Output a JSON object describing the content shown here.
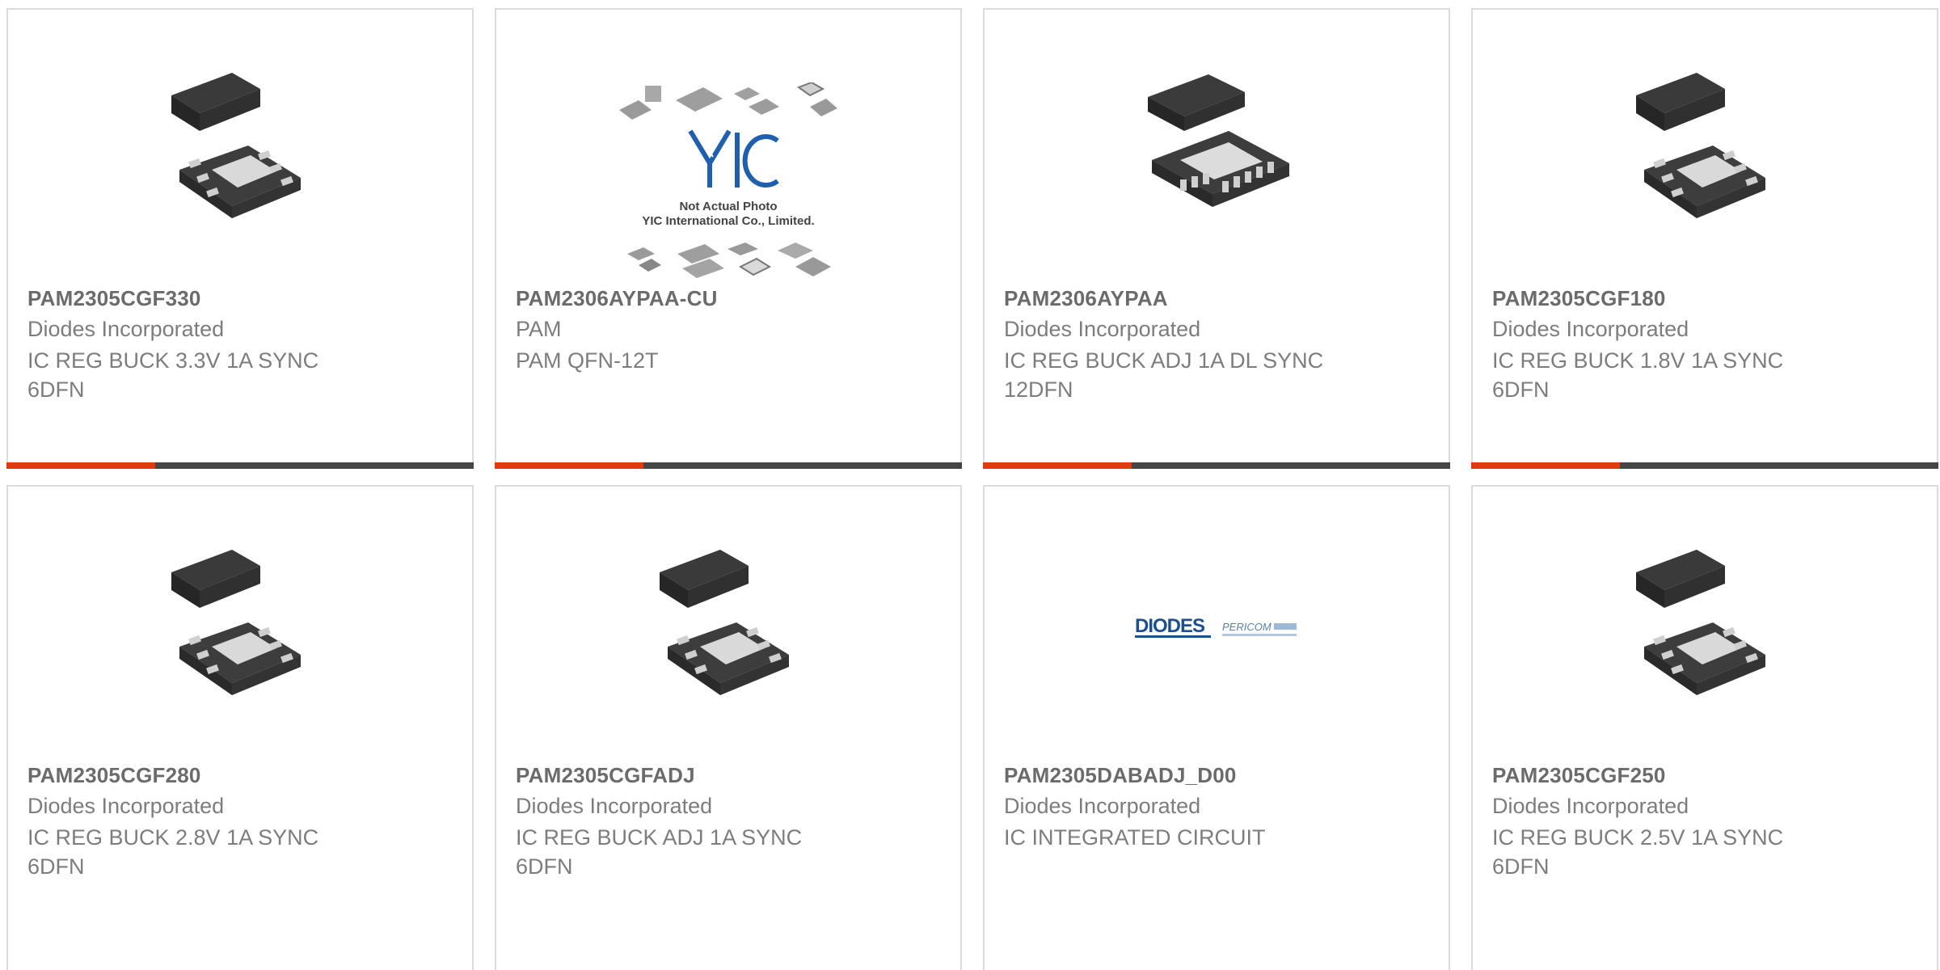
{
  "accent_color": "#e03a10",
  "bar_color": "#454545",
  "products": [
    {
      "part": "PAM2305CGF330",
      "maker": "Diodes Incorporated",
      "desc": "IC REG BUCK 3.3V 1A SYNC 6DFN",
      "image_icon": "dfn6-chip-icon"
    },
    {
      "part": "PAM2306AYPAA-CU",
      "maker": "PAM",
      "desc": "PAM QFN-12T",
      "image_icon": "yic-placeholder-icon",
      "image_text": {
        "logo": "YIC",
        "line1": "Not Actual Photo",
        "line2": "YIC International Co., Limited."
      }
    },
    {
      "part": "PAM2306AYPAA",
      "maker": "Diodes Incorporated",
      "desc": "IC REG BUCK ADJ 1A DL SYNC 12DFN",
      "image_icon": "dfn12-chip-icon"
    },
    {
      "part": "PAM2305CGF180",
      "maker": "Diodes Incorporated",
      "desc": "IC REG BUCK 1.8V 1A SYNC 6DFN",
      "image_icon": "dfn6-chip-icon"
    },
    {
      "part": "PAM2305CGF280",
      "maker": "Diodes Incorporated",
      "desc": "IC REG BUCK 2.8V 1A SYNC 6DFN",
      "image_icon": "dfn6-chip-icon"
    },
    {
      "part": "PAM2305CGFADJ",
      "maker": "Diodes Incorporated",
      "desc": "IC REG BUCK ADJ 1A SYNC 6DFN",
      "image_icon": "dfn6-chip-icon"
    },
    {
      "part": "PAM2305DABADJ_D00",
      "maker": "Diodes Incorporated",
      "desc": "IC INTEGRATED CIRCUIT",
      "image_icon": "diodes-pericom-logo-icon",
      "image_text": {
        "logo1": "DIODES",
        "logo2": "PERICOM"
      }
    },
    {
      "part": "PAM2305CGF250",
      "maker": "Diodes Incorporated",
      "desc": "IC REG BUCK 2.5V 1A SYNC 6DFN",
      "image_icon": "dfn6-chip-icon"
    }
  ]
}
